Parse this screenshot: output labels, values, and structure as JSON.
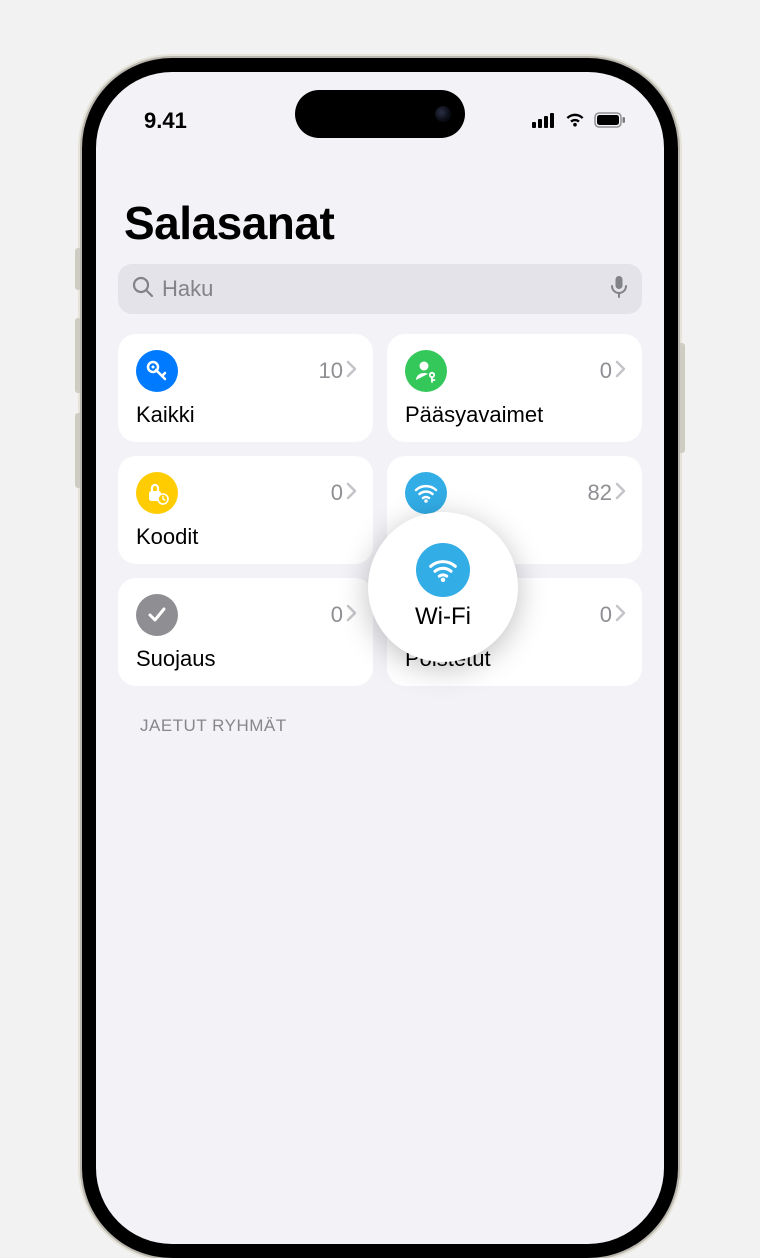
{
  "status": {
    "time": "9.41"
  },
  "title": "Salasanat",
  "search": {
    "placeholder": "Haku"
  },
  "tiles": [
    {
      "id": "all",
      "label": "Kaikki",
      "count": 10,
      "icon": "key-icon",
      "color": "ic-blue"
    },
    {
      "id": "passkeys",
      "label": "Pääsyavaimet",
      "count": 0,
      "icon": "person-key-icon",
      "color": "ic-green"
    },
    {
      "id": "codes",
      "label": "Koodit",
      "count": 0,
      "icon": "lock-clock-icon",
      "color": "ic-yellow"
    },
    {
      "id": "wifi",
      "label": "Wi-Fi",
      "count": 82,
      "icon": "wifi-icon",
      "color": "ic-cyan"
    },
    {
      "id": "security",
      "label": "Suojaus",
      "count": 0,
      "icon": "check-icon",
      "color": "ic-gray"
    },
    {
      "id": "deleted",
      "label": "Poistetut",
      "count": 0,
      "icon": "trash-icon",
      "color": "ic-orange"
    }
  ],
  "highlight": {
    "label": "Wi-Fi",
    "icon": "wifi-icon",
    "color": "ic-cyan"
  },
  "section_header": "JAETUT RYHMÄT"
}
